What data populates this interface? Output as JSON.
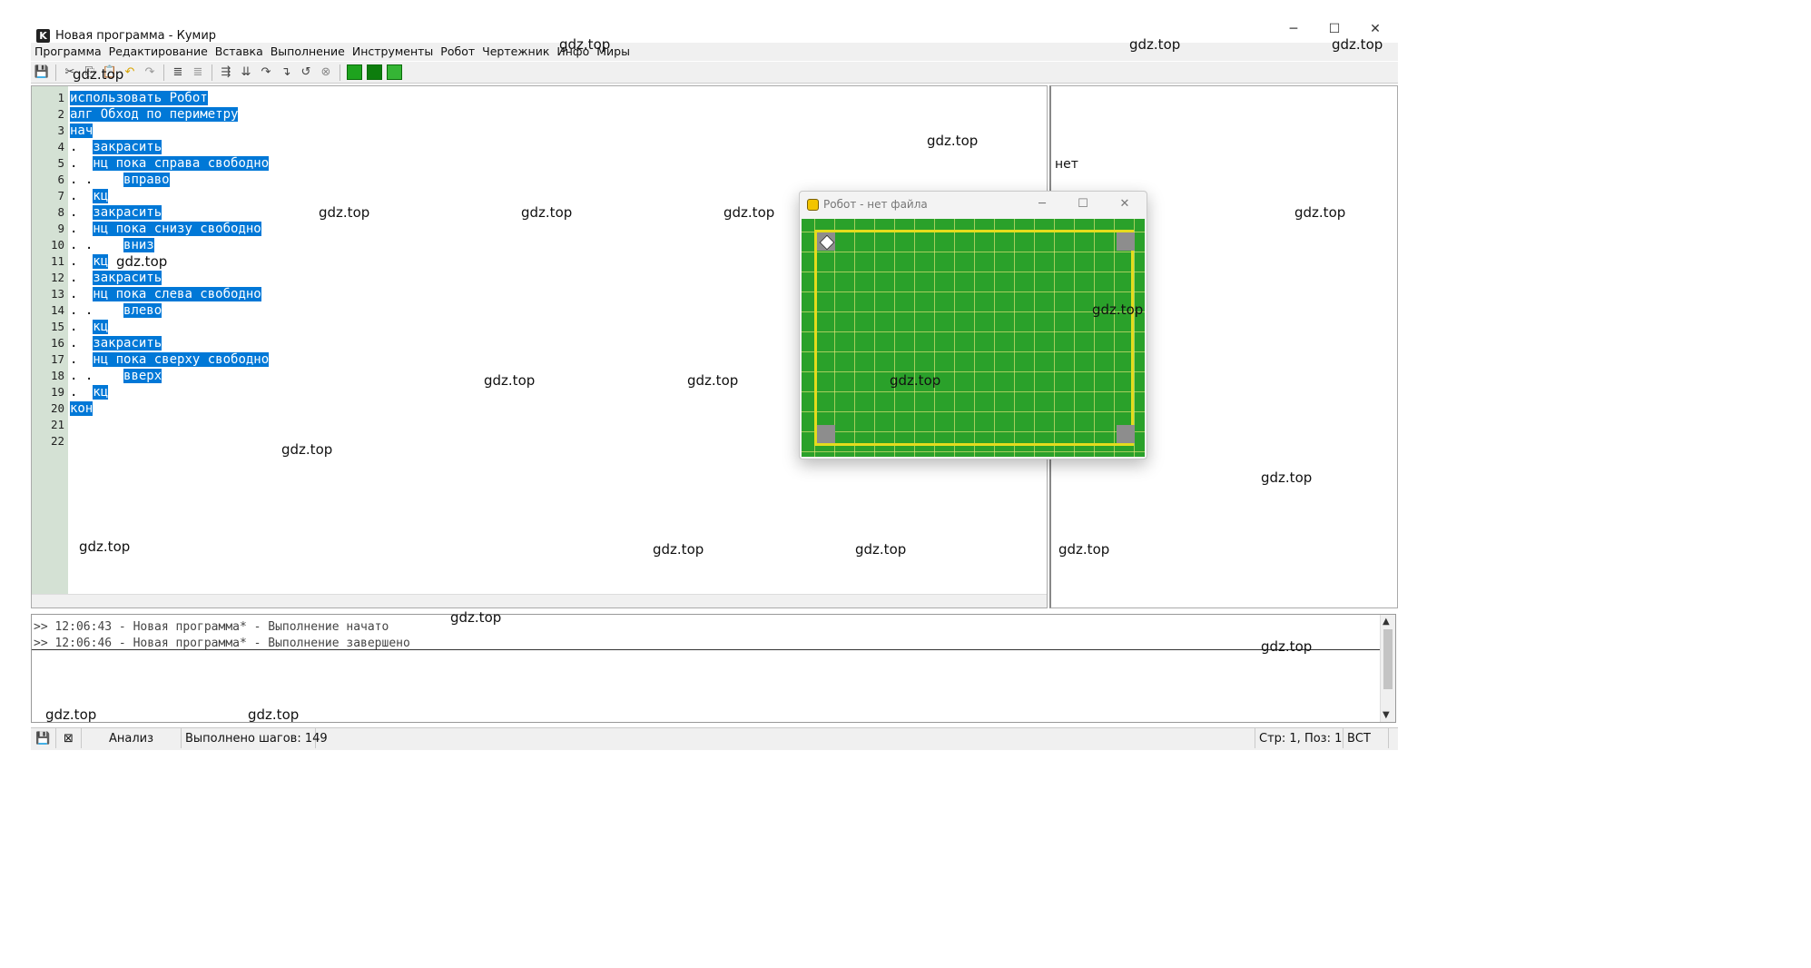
{
  "window": {
    "title": "Новая программа - Кумир",
    "logo_letter": "K"
  },
  "menu": [
    "Программа",
    "Редактирование",
    "Вставка",
    "Выполнение",
    "Инструменты",
    "Робот",
    "Чертежник",
    "Инфо",
    "Миры"
  ],
  "editor": {
    "lines": [
      {
        "n": "1",
        "dots": "",
        "text": "использовать Робот"
      },
      {
        "n": "2",
        "dots": "",
        "text": "алг Обход по периметру"
      },
      {
        "n": "3",
        "dots": "",
        "text": "нач"
      },
      {
        "n": "4",
        "dots": ".",
        "text": "закрасить"
      },
      {
        "n": "5",
        "dots": ".",
        "text": "нц пока справа свободно"
      },
      {
        "n": "6",
        "dots": ". .",
        "text": "вправо"
      },
      {
        "n": "7",
        "dots": ".",
        "text": "кц"
      },
      {
        "n": "8",
        "dots": ".",
        "text": "закрасить"
      },
      {
        "n": "9",
        "dots": ".",
        "text": "нц пока снизу свободно"
      },
      {
        "n": "10",
        "dots": ". .",
        "text": "вниз"
      },
      {
        "n": "11",
        "dots": ".",
        "text": "кц"
      },
      {
        "n": "12",
        "dots": ".",
        "text": "закрасить"
      },
      {
        "n": "13",
        "dots": ".",
        "text": "нц пока слева свободно"
      },
      {
        "n": "14",
        "dots": ". .",
        "text": "влево"
      },
      {
        "n": "15",
        "dots": ".",
        "text": "кц"
      },
      {
        "n": "16",
        "dots": ".",
        "text": "закрасить"
      },
      {
        "n": "17",
        "dots": ".",
        "text": "нц пока сверху свободно"
      },
      {
        "n": "18",
        "dots": ". .",
        "text": "вверх"
      },
      {
        "n": "19",
        "dots": ".",
        "text": "кц"
      },
      {
        "n": "20",
        "dots": "",
        "text": "кон"
      },
      {
        "n": "21",
        "dots": "",
        "text": ""
      },
      {
        "n": "22",
        "dots": "",
        "text": ""
      }
    ]
  },
  "margin": {
    "text": "нет"
  },
  "robot_window": {
    "title": "Робот - нет файла"
  },
  "console": {
    "lines": [
      ">> 12:06:43 - Новая программа* - Выполнение начато",
      ">> 12:06:46 - Новая программа* - Выполнение завершено"
    ]
  },
  "status": {
    "mode": "Анализ",
    "steps": "Выполнено шагов: 149",
    "position": "Стр: 1, Поз: 1",
    "insert": "ВСТ"
  },
  "watermark": "gdz.top",
  "colors": {
    "selection": "#0078d7",
    "field": "#2aa12a",
    "wall": "#e4dc1c",
    "painted": "#8d8d8d"
  }
}
